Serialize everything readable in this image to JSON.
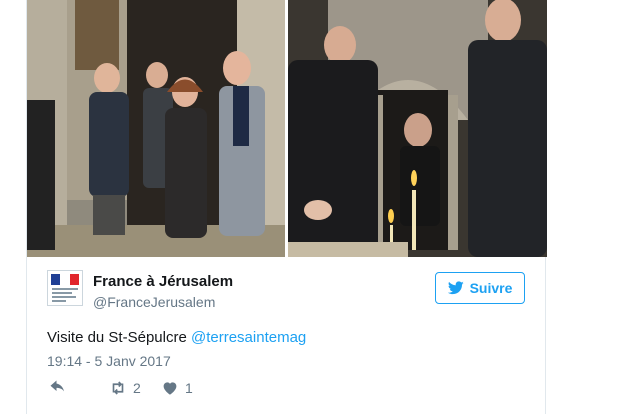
{
  "tweet": {
    "author_name": "France à Jérusalem",
    "author_handle": "@FranceJerusalem",
    "follow_label": "Suivre",
    "text": "Visite du St-Sépulcre",
    "mention": "@terresaintemag",
    "timestamp": "19:14 - 5 Janv 2017",
    "retweet_count": "2",
    "like_count": "1"
  },
  "icons": {
    "reply": "reply-icon",
    "retweet": "retweet-icon",
    "like": "heart-icon",
    "bird": "twitter-bird-icon"
  },
  "colors": {
    "accent": "#1da1f2",
    "text": "#14171a",
    "secondary": "#657786",
    "border": "#e1e8ed"
  }
}
